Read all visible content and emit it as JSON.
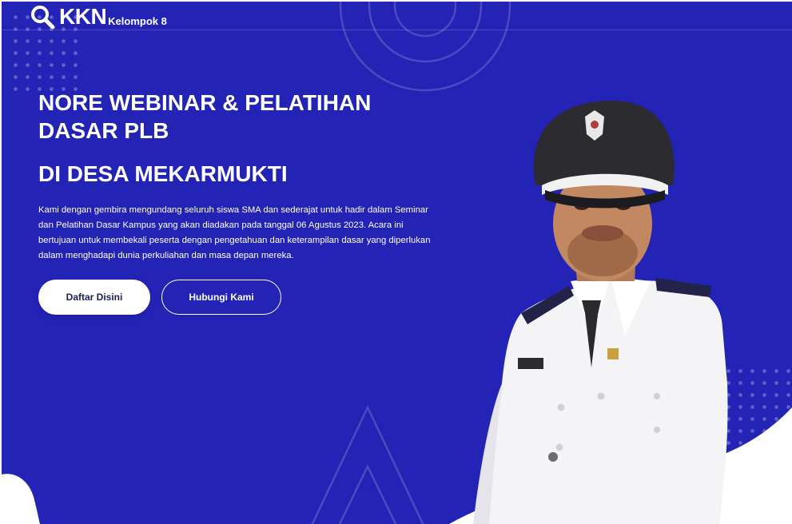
{
  "brand": {
    "name": "KKN",
    "group": "Kelompok 8",
    "logo_icon": "search-icon"
  },
  "hero": {
    "title": "NORE WEBINAR & PELATIHAN DASAR PLB",
    "subtitle": "DI DESA MEKARMUKTI",
    "description": "Kami dengan gembira mengundang seluruh siswa SMA dan sederajat untuk hadir dalam Seminar dan Pelatihan Dasar Kampus yang akan diadakan pada tanggal 06 Agustus 2023. Acara ini bertujuan untuk membekali peserta dengan pengetahuan dan keterampilan dasar yang diperlukan dalam menghadapi dunia perkuliahan dan masa depan mereka.",
    "primary_button": "Daftar Disini",
    "secondary_button": "Hubungi Kami"
  },
  "colors": {
    "background": "#2324b5",
    "primary_button_bg": "#ffffff",
    "primary_button_text": "#1b1c5a",
    "text": "#ffffff"
  }
}
